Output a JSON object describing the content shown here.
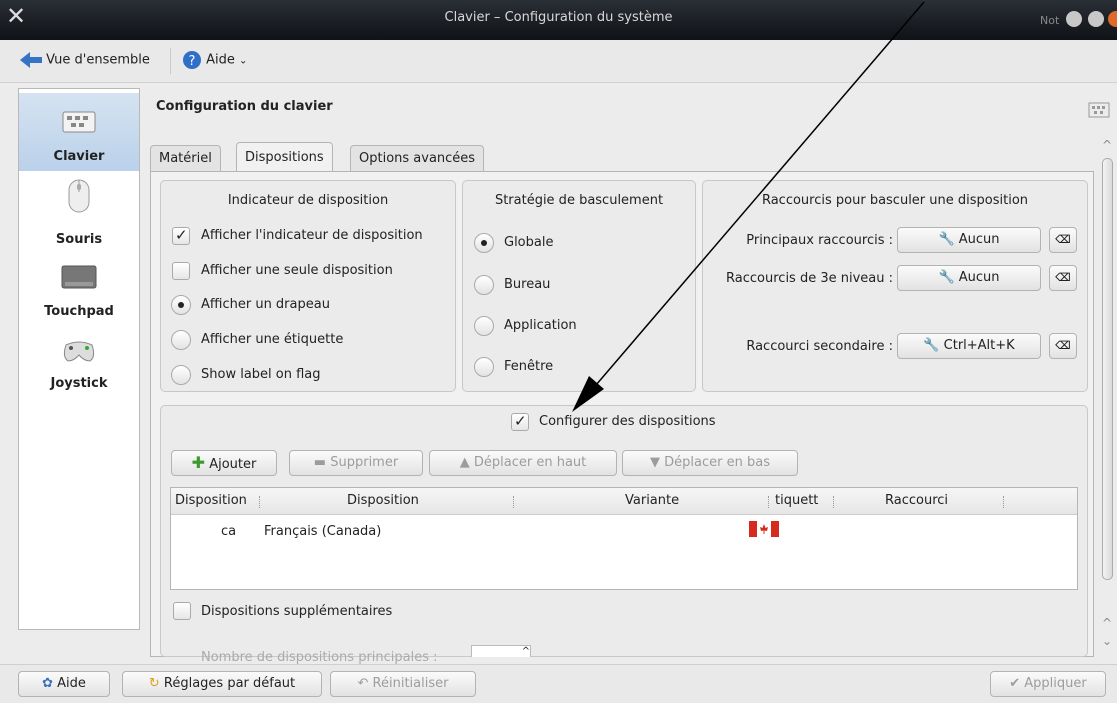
{
  "window": {
    "title": "Clavier – Configuration du système",
    "corner_text": "Not"
  },
  "toolbar": {
    "overview": "Vue d'ensemble",
    "help": "Aide"
  },
  "sidebar": {
    "items": [
      {
        "label": "Clavier",
        "icon": "keyboard-icon",
        "selected": true
      },
      {
        "label": "Souris",
        "icon": "mouse-icon",
        "selected": false
      },
      {
        "label": "Touchpad",
        "icon": "touchpad-icon",
        "selected": false
      },
      {
        "label": "Joystick",
        "icon": "gamepad-icon",
        "selected": false
      }
    ]
  },
  "main": {
    "title": "Configuration du clavier",
    "tabs": [
      "Matériel",
      "Dispositions",
      "Options avancées"
    ],
    "active_tab": "Dispositions",
    "indicator": {
      "title": "Indicateur de disposition",
      "options": [
        "Afficher l'indicateur de disposition",
        "Afficher une seule disposition",
        "Afficher un drapeau",
        "Afficher une étiquette",
        "Show label on flag"
      ]
    },
    "strategy": {
      "title": "Stratégie de basculement",
      "options": [
        "Globale",
        "Bureau",
        "Application",
        "Fenêtre"
      ],
      "selected": "Globale"
    },
    "shortcuts": {
      "title": "Raccourcis pour basculer une disposition",
      "main_label": "Principaux raccourcis :",
      "main_value": "Aucun",
      "level3_label": "Raccourcis de 3e niveau :",
      "level3_value": "Aucun",
      "secondary_label": "Raccourci secondaire :",
      "secondary_value": "Ctrl+Alt+K"
    },
    "configure_layouts": "Configurer des dispositions",
    "buttons": {
      "add": "Ajouter",
      "remove": "Supprimer",
      "up": "Déplacer en haut",
      "down": "Déplacer en bas"
    },
    "table": {
      "headers": [
        "Disposition",
        "Disposition",
        "Variante",
        "tiquett",
        "Raccourci"
      ],
      "rows": [
        {
          "code": "ca",
          "name": "Français (Canada)",
          "variant": "",
          "label": "canada-flag-icon",
          "shortcut": ""
        }
      ]
    },
    "extra_layouts": "Dispositions supplémentaires",
    "main_count_label": "Nombre de dispositions principales :"
  },
  "bottom": {
    "help": "Aide",
    "defaults": "Réglages par défaut",
    "reset": "Réinitialiser",
    "apply": "Appliquer"
  },
  "colors": {
    "selection": "#c6d9ee",
    "titlebar": "#1a1e24",
    "arrow": "#000000"
  }
}
